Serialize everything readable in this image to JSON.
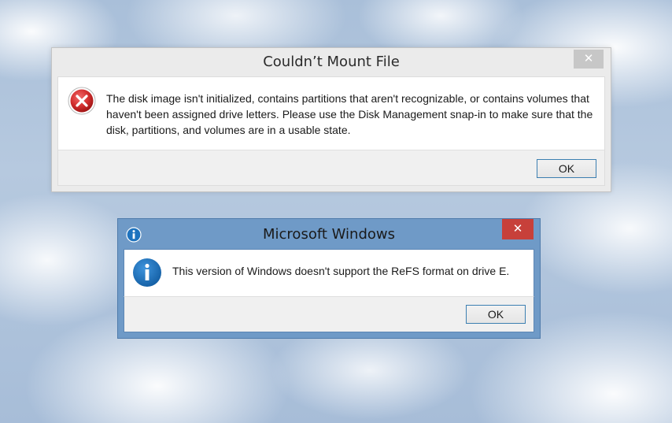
{
  "dialogs": {
    "mount_error": {
      "title": "Couldn’t Mount File",
      "close_glyph": "✕",
      "icon": "error-icon",
      "message": "The disk image isn't initialized, contains partitions that aren't recognizable, or contains volumes that haven't been assigned drive letters. Please use the Disk Management snap-in to make sure that the disk, partitions, and volumes are in a usable state.",
      "ok_label": "OK"
    },
    "refs_info": {
      "title": "Microsoft Windows",
      "close_glyph": "✕",
      "title_icon": "info-icon",
      "icon": "info-icon",
      "message": "This version of Windows doesn't support the ReFS format on drive E.",
      "ok_label": "OK"
    }
  },
  "colors": {
    "active_frame": "#6f9ac7",
    "inactive_frame": "#ebebeb",
    "close_active": "#c7403a",
    "close_inactive": "#c7c7c7",
    "error_red": "#d32f2f",
    "info_blue": "#1e73be",
    "button_focus_border": "#3c7fb1"
  }
}
